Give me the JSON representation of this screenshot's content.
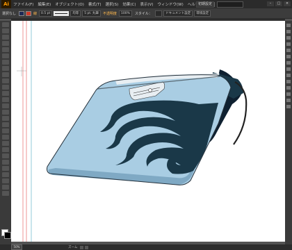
{
  "menubar": {
    "logo": "Ai",
    "items": [
      "ファイル(F)",
      "編集(E)",
      "オブジェクト(O)",
      "書式(T)",
      "選択(S)",
      "効果(C)",
      "表示(V)",
      "ウィンドウ(W)",
      "ヘルプ(H)"
    ],
    "workspace": "初期設定",
    "window_buttons": [
      "–",
      "□",
      "×"
    ]
  },
  "controlbar": {
    "selection": "選択なし",
    "stroke_label": "線",
    "stroke_weight": "0.5 pt",
    "uniform": "均等",
    "brush": "5 pt. 丸筆",
    "opacity_label": "不透明度",
    "opacity": "100%",
    "style_label": "スタイル：",
    "doc_setup": "ドキュメント設定",
    "prefs": "環境設定",
    "colors": {
      "fill": "#1e2a55",
      "stroke": "#cc3a2a"
    }
  },
  "statusbar": {
    "zoom": "50%",
    "tool": "ズーム"
  },
  "colors": {
    "panel": "#3c3c3c",
    "canvas": "#ffffff",
    "accent": "#ff9a00"
  },
  "artwork": {
    "subject": "flame-decal-illustration",
    "body_fill": "#a9cde3",
    "flame_fill": "#1a3848",
    "accent_fill": "#0f2030",
    "trim": "#e8eef2"
  }
}
